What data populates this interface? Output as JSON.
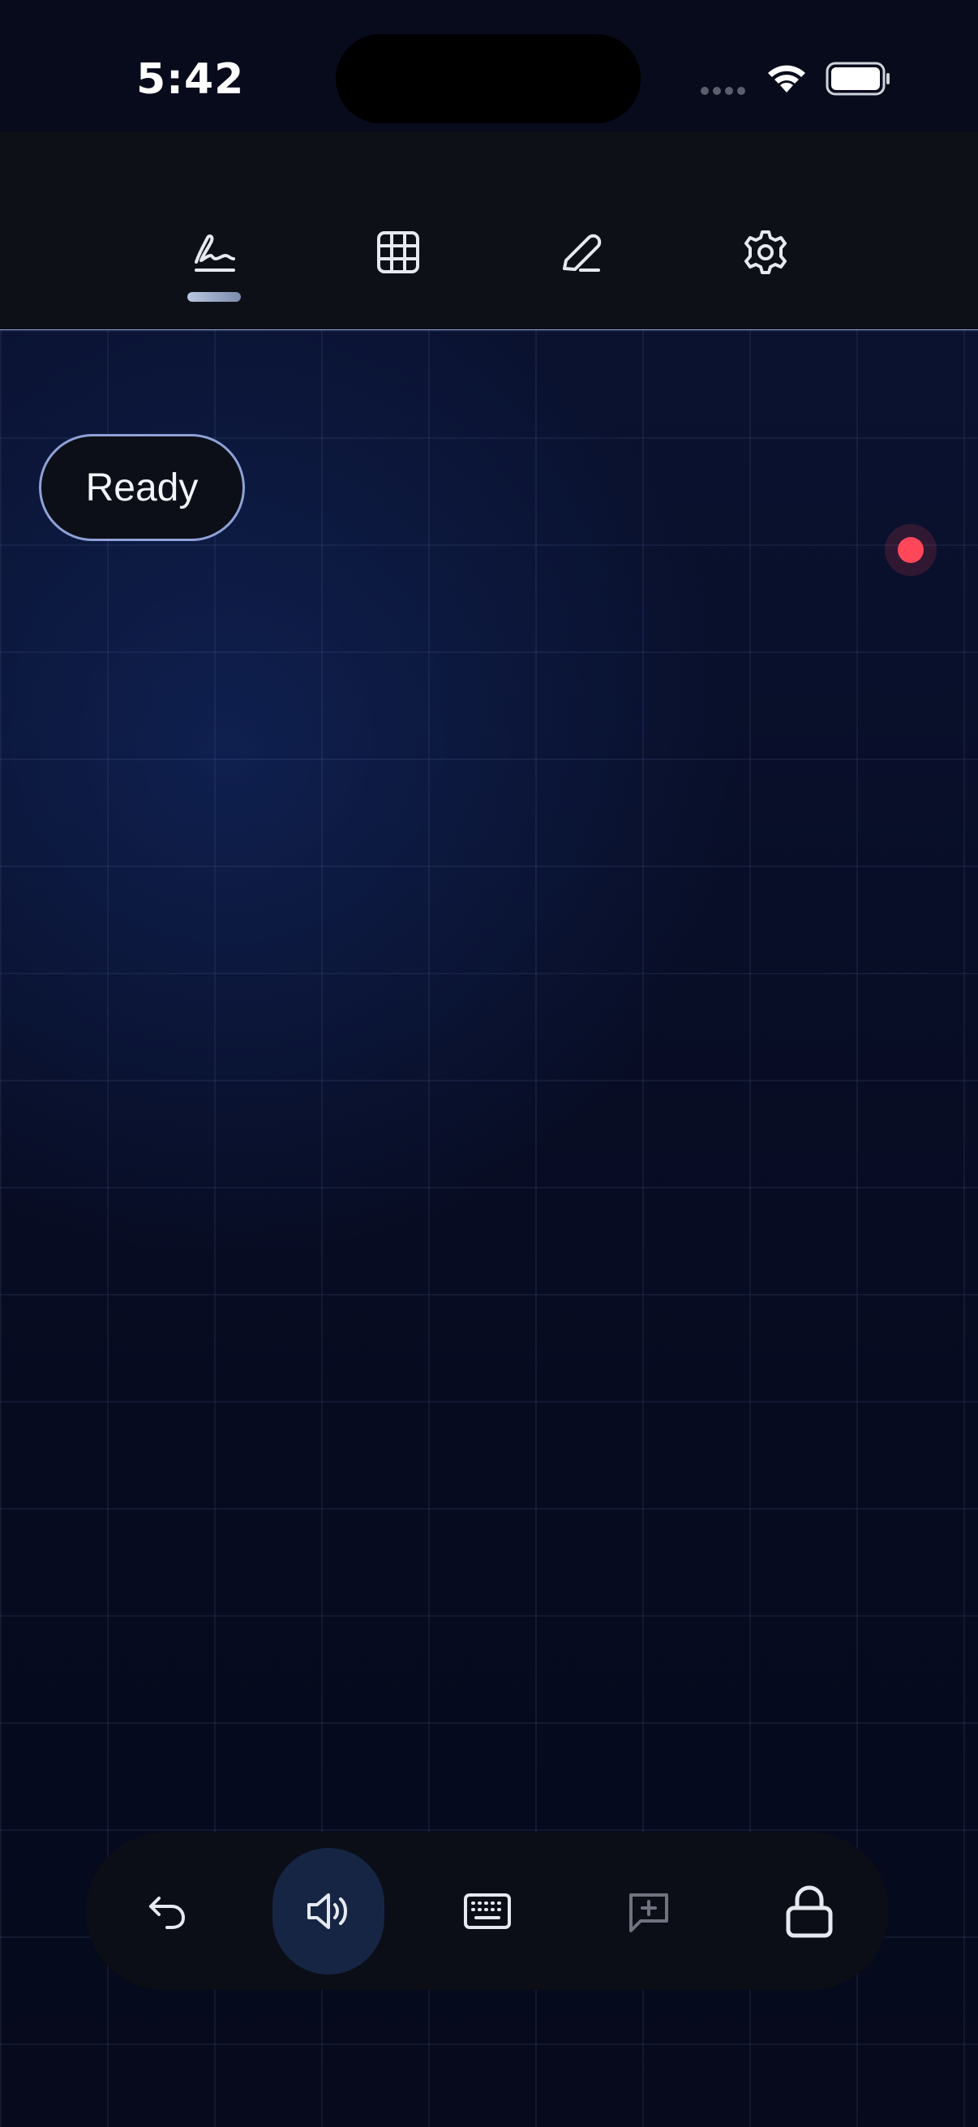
{
  "status_bar": {
    "time": "5:42",
    "icons": [
      "cellular-signal-icon",
      "wifi-icon",
      "battery-icon"
    ]
  },
  "toolbar": {
    "tabs": [
      {
        "icon": "signature-icon",
        "selected": true
      },
      {
        "icon": "grid-icon",
        "selected": false
      },
      {
        "icon": "pen-icon",
        "selected": false
      },
      {
        "icon": "gear-icon",
        "selected": false
      }
    ]
  },
  "canvas": {
    "status_pill": "Ready",
    "recording_indicator_color": "#ff4759"
  },
  "bottom_bar": {
    "buttons": [
      {
        "icon": "undo-icon",
        "active": false
      },
      {
        "icon": "speaker-icon",
        "active": true
      },
      {
        "icon": "keyboard-icon",
        "active": false
      },
      {
        "icon": "add-comment-icon",
        "active": false,
        "dimmed": true
      },
      {
        "icon": "lock-icon",
        "active": false
      }
    ]
  },
  "colors": {
    "accent_border": "#8fa2d6",
    "active_button_bg": "#172545",
    "record": "#ff4759"
  }
}
